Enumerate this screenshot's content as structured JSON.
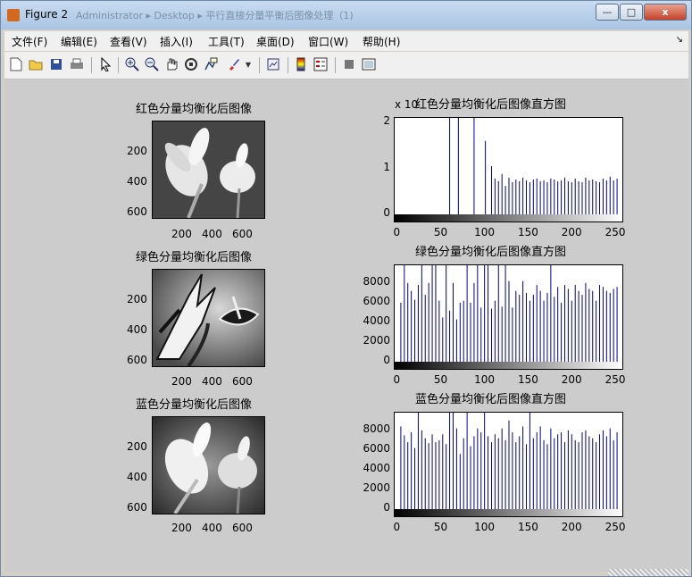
{
  "window": {
    "title": "Figure 2",
    "background_path": "Administrator ▸ Desktop ▸ 平行直接分量平衡后图像处理（1)",
    "buttons": {
      "minimize": "—",
      "maximize": "□",
      "close": "x"
    }
  },
  "menu": {
    "items": [
      "文件(F)",
      "编辑(E)",
      "查看(V)",
      "插入(I)",
      "工具(T)",
      "桌面(D)",
      "窗口(W)",
      "帮助(H)"
    ],
    "overflow": "↘"
  },
  "toolbar": {
    "icons": [
      "new-file-icon",
      "open-folder-icon",
      "save-icon",
      "print-icon",
      "select-arrow-icon",
      "zoom-in-icon",
      "zoom-out-icon",
      "pan-hand-icon",
      "rotate-3d-icon",
      "data-cursor-icon",
      "brush-icon",
      "dropdown-icon",
      "link-plot-icon",
      "colorbar-icon",
      "legend-icon",
      "hide-plot-tools-icon",
      "show-plot-tools-icon"
    ]
  },
  "image_panels": [
    {
      "title": "红色分量均衡化后图像",
      "yticks": [
        "200",
        "400",
        "600"
      ],
      "xticks": [
        "200",
        "400",
        "600"
      ]
    },
    {
      "title": "绿色分量均衡化后图像",
      "yticks": [
        "200",
        "400",
        "600"
      ],
      "xticks": [
        "200",
        "400",
        "600"
      ]
    },
    {
      "title": "蓝色分量均衡化后图像",
      "yticks": [
        "200",
        "400",
        "600"
      ],
      "xticks": [
        "200",
        "400",
        "600"
      ]
    }
  ],
  "chart_data": [
    {
      "type": "bar",
      "title": "红色分量均衡化后图像直方图",
      "exponent_label": "x 10",
      "ylim": [
        0,
        2.1
      ],
      "xlim": [
        0,
        255
      ],
      "yticks": [
        "0",
        "1",
        "2"
      ],
      "xticks": [
        "0",
        "50",
        "100",
        "150",
        "200",
        "250"
      ],
      "x": [
        60,
        70,
        88,
        101,
        108,
        112,
        116,
        120,
        124,
        128,
        132,
        136,
        140,
        144,
        148,
        152,
        156,
        160,
        164,
        168,
        172,
        176,
        180,
        184,
        188,
        192,
        196,
        200,
        204,
        208,
        212,
        216,
        220,
        224,
        228,
        232,
        236,
        240,
        244,
        248,
        252
      ],
      "values": [
        2.1,
        2.1,
        2.1,
        1.6,
        1.05,
        0.78,
        0.72,
        0.88,
        0.62,
        0.8,
        0.7,
        0.76,
        0.72,
        0.8,
        0.74,
        0.7,
        0.76,
        0.78,
        0.72,
        0.74,
        0.7,
        0.78,
        0.76,
        0.72,
        0.74,
        0.8,
        0.72,
        0.7,
        0.78,
        0.72,
        0.7,
        0.8,
        0.74,
        0.76,
        0.72,
        0.7,
        0.78,
        0.74,
        0.82,
        0.74,
        0.78
      ],
      "bar_color": "#00008b"
    },
    {
      "type": "bar",
      "title": "绿色分量均衡化后图像直方图",
      "ylim": [
        0,
        9800
      ],
      "xlim": [
        0,
        255
      ],
      "yticks": [
        "0",
        "2000",
        "4000",
        "6000",
        "8000"
      ],
      "xticks": [
        "0",
        "50",
        "100",
        "150",
        "200",
        "250"
      ],
      "x": [
        4,
        8,
        12,
        16,
        20,
        24,
        28,
        32,
        36,
        40,
        44,
        48,
        52,
        56,
        60,
        64,
        68,
        72,
        76,
        80,
        84,
        88,
        92,
        96,
        100,
        104,
        108,
        112,
        116,
        120,
        124,
        128,
        132,
        136,
        140,
        144,
        148,
        152,
        156,
        160,
        164,
        168,
        172,
        176,
        180,
        184,
        188,
        192,
        196,
        200,
        204,
        208,
        212,
        216,
        220,
        224,
        228,
        232,
        236,
        240,
        244,
        248,
        252
      ],
      "values": [
        6000,
        9800,
        8000,
        7200,
        6300,
        7800,
        9800,
        6800,
        8000,
        9800,
        9800,
        6200,
        4500,
        9800,
        5200,
        8000,
        4300,
        6000,
        6200,
        9800,
        6000,
        8000,
        9800,
        5500,
        9800,
        9800,
        5400,
        6200,
        9800,
        5600,
        9800,
        8200,
        5500,
        7200,
        6800,
        8200,
        7000,
        6200,
        6800,
        7800,
        7200,
        6200,
        7000,
        9800,
        6600,
        7600,
        6000,
        7800,
        7400,
        6200,
        7800,
        7200,
        6800,
        8000,
        7400,
        7200,
        6200,
        7800,
        7600,
        7200,
        7000,
        7400,
        7600
      ],
      "bar_color": "#00008b"
    },
    {
      "type": "bar",
      "title": "蓝色分量均衡化后图像直方图",
      "ylim": [
        0,
        9800
      ],
      "xlim": [
        0,
        255
      ],
      "yticks": [
        "0",
        "2000",
        "4000",
        "6000",
        "8000"
      ],
      "xticks": [
        "0",
        "50",
        "100",
        "150",
        "200",
        "250"
      ],
      "x": [
        4,
        8,
        12,
        16,
        20,
        24,
        28,
        32,
        36,
        40,
        44,
        48,
        52,
        56,
        60,
        64,
        68,
        72,
        76,
        80,
        84,
        88,
        92,
        96,
        100,
        104,
        108,
        112,
        116,
        120,
        124,
        128,
        132,
        136,
        140,
        144,
        148,
        152,
        156,
        160,
        164,
        168,
        172,
        176,
        180,
        184,
        188,
        192,
        196,
        200,
        204,
        208,
        212,
        216,
        220,
        224,
        228,
        232,
        236,
        240,
        244,
        248,
        252
      ],
      "values": [
        8400,
        7500,
        6800,
        7800,
        6200,
        9800,
        8000,
        7200,
        6700,
        7600,
        6800,
        7000,
        7600,
        6600,
        9800,
        9800,
        8200,
        5600,
        7200,
        9800,
        6400,
        7400,
        8200,
        7800,
        9800,
        7400,
        6800,
        7600,
        7200,
        8200,
        7000,
        9000,
        7800,
        6800,
        7400,
        8400,
        6600,
        9800,
        7200,
        7800,
        8400,
        7000,
        6600,
        8200,
        7200,
        7600,
        7800,
        6800,
        8000,
        7600,
        7000,
        6800,
        7800,
        8000,
        7400,
        7200,
        6800,
        7600,
        8000,
        7400,
        8200,
        7000,
        7800
      ],
      "bar_color": "#00008b"
    }
  ]
}
